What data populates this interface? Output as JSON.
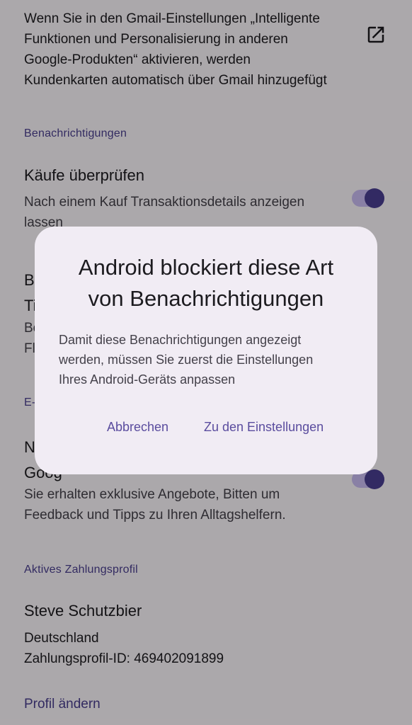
{
  "intro": {
    "lines": [
      "Wenn Sie in den Gmail-Einstellungen „Intelligente",
      "Funktionen und Personalisierung in anderen",
      "Google-Produkten“ aktivieren, werden",
      "Kundenkarten automatisch über Gmail hinzugefügt"
    ],
    "icon": "open-in-new-icon"
  },
  "notifications": {
    "header": "Benachrichtigungen",
    "review_purchases": {
      "title": "Käufe überprüfen",
      "sub_lines": [
        "Nach einem Kauf Transaktionsdetails anzeigen",
        "lassen"
      ],
      "toggle_on": true
    },
    "hidden_item": {
      "title_lines": [
        "B",
        "Ti"
      ],
      "sub_lines": [
        "Be",
        "Fl"
      ]
    }
  },
  "email": {
    "header_partial": "E-",
    "item": {
      "title_lines": [
        "N",
        "Goog"
      ],
      "sub_lines": [
        "Sie erhalten exklusive Angebote, Bitten um",
        "Feedback und Tipps zu Ihren Alltagshelfern."
      ],
      "toggle_on": true
    }
  },
  "payment_profile": {
    "header": "Aktives Zahlungsprofil",
    "name": "Steve Schutzbier",
    "country": "Deutschland",
    "profile_id": "Zahlungsprofil-ID: 469402091899",
    "change_link": "Profil ändern"
  },
  "dialog": {
    "title_lines": [
      "Android blockiert diese Art",
      "von Benachrichtigungen"
    ],
    "body_lines": [
      "Damit diese Benachrichtigungen angezeigt",
      "werden, müssen Sie zuerst die Einstellungen",
      "Ihres Android-Geräts anpassen"
    ],
    "cancel": "Abbrechen",
    "settings": "Zu den Einstellungen"
  },
  "colors": {
    "accent": "#4a3f8f",
    "toggle_thumb": "#4b3e93",
    "toggle_track": "#cbbdf3",
    "dialog_bg": "#f1ecf4",
    "scrim": "rgba(0,0,0,0.32)"
  }
}
